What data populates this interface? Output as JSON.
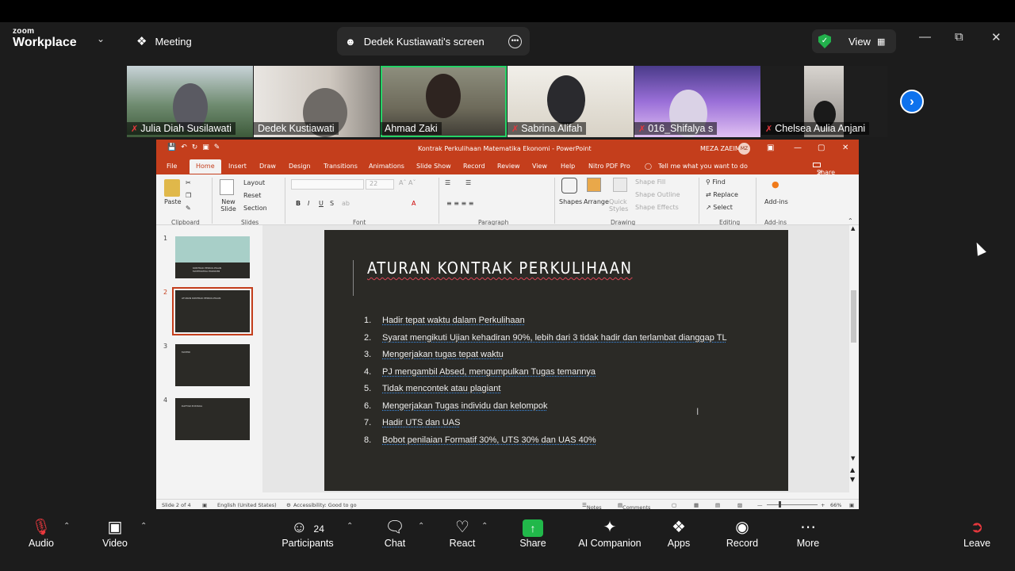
{
  "topbar": {
    "brand_small": "zoom",
    "brand": "Workplace",
    "meeting": "Meeting",
    "screen_title": "Dedek Kustiawati's screen",
    "view": "View"
  },
  "participants": [
    {
      "name": "Julia Diah Susilawati",
      "muted": true
    },
    {
      "name": "Dedek Kustiawati",
      "muted": false
    },
    {
      "name": "Ahmad Zaki",
      "muted": false,
      "active": true
    },
    {
      "name": "Sabrina Alifah",
      "muted": true
    },
    {
      "name": "016_Shifalya s",
      "muted": true
    },
    {
      "name": "Chelsea Aulia Anjani",
      "muted": true
    }
  ],
  "ppt": {
    "title": "Kontrak Perkulihaan Matematika Ekonomi  -  PowerPoint",
    "user": "MEZA ZAEIM",
    "user_initials": "MZ",
    "tabs": [
      "File",
      "Home",
      "Insert",
      "Draw",
      "Design",
      "Transitions",
      "Animations",
      "Slide Show",
      "Record",
      "Review",
      "View",
      "Help",
      "Nitro PDF Pro",
      "Tell me what you want to do"
    ],
    "share": "Share",
    "ribbon": {
      "groups": [
        "Clipboard",
        "Slides",
        "Font",
        "Paragraph",
        "Drawing",
        "Editing",
        "Add-ins"
      ],
      "paste": "Paste",
      "new_slide": "New Slide",
      "layout": "Layout",
      "reset": "Reset",
      "section": "Section",
      "font_size": "22",
      "shapes": "Shapes",
      "arrange": "Arrange",
      "quick_styles": "Quick Styles",
      "shape_fill": "Shape Fill",
      "shape_outline": "Shape Outline",
      "shape_effects": "Shape Effects",
      "find": "Find",
      "replace": "Replace",
      "select": "Select",
      "addins": "Add-ins"
    },
    "slide_numbers": [
      "1",
      "2",
      "3",
      "4"
    ],
    "thumb_titles": [
      "KONTRAK PERKULIHAAN MATEMATIKA EKONOMI",
      "ATURAN KONTRAK PERKULIHAAN",
      "MATERI",
      "DAFTAR PUSTAKA"
    ],
    "slide": {
      "title": "ATURAN KONTRAK PERKULIHAAN",
      "items": [
        "Hadir tepat waktu dalam Perkulihaan",
        "Syarat mengikuti Ujian kehadiran 90%, lebih dari 3 tidak hadir  dan terlambat dianggap TL",
        "Mengerjakan tugas tepat waktu",
        "PJ mengambil Absed, mengumpulkan Tugas temannya",
        "Tidak mencontek atau plagiant",
        "Mengerjakan Tugas individu dan kelompok",
        "Hadir UTS dan UAS",
        "Bobot penilaian Formatif 30%, UTS 30% dan UAS 40%"
      ]
    },
    "status": {
      "slide": "Slide 2 of 4",
      "lang": "English (United States)",
      "access": "Accessibility: Good to go",
      "notes": "Notes",
      "comments": "Comments",
      "zoom": "66%"
    }
  },
  "bottom": {
    "audio": "Audio",
    "video": "Video",
    "participants": "Participants",
    "participants_count": "24",
    "chat": "Chat",
    "react": "React",
    "share": "Share",
    "ai": "AI Companion",
    "apps": "Apps",
    "record": "Record",
    "more": "More",
    "leave": "Leave"
  },
  "colors": {
    "accent": "#0e72ed",
    "ppt_red": "#c43e1c",
    "active_tile": "#25d366",
    "mute_red": "#e8383d"
  }
}
